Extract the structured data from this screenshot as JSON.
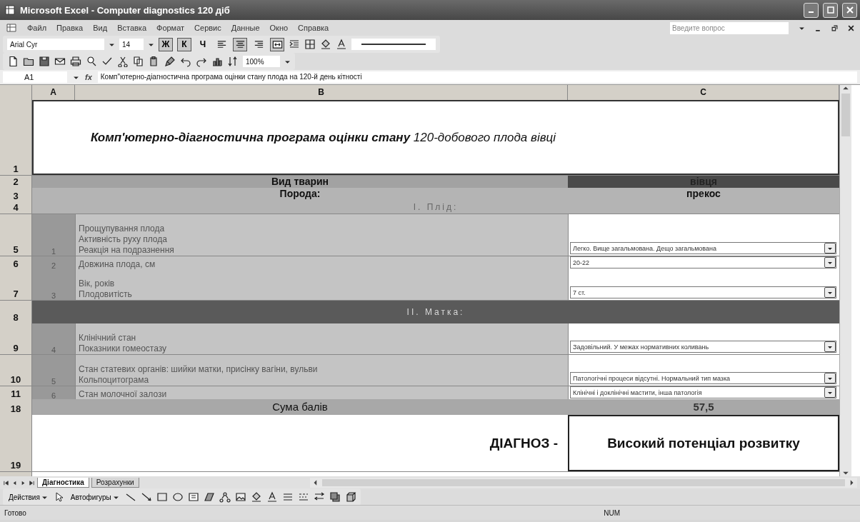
{
  "window": {
    "title": "Microsoft Excel - Computer diagnostics 120 діб"
  },
  "menu": [
    "Файл",
    "Правка",
    "Вид",
    "Вставка",
    "Формат",
    "Сервис",
    "Данные",
    "Окно",
    "Справка"
  ],
  "help_search": {
    "placeholder": "Введите вопрос"
  },
  "formatting_toolbar": {
    "font": "Arial Cyr",
    "size": "14",
    "style_buttons": [
      {
        "label": "Ж",
        "pressed": true
      },
      {
        "label": "К",
        "pressed": true
      },
      {
        "label": "Ч",
        "pressed": false
      }
    ],
    "align_buttons": [
      {
        "kind": "left",
        "pressed": false
      },
      {
        "kind": "center",
        "pressed": true
      },
      {
        "kind": "right",
        "pressed": false
      },
      {
        "kind": "merge",
        "pressed": true
      }
    ]
  },
  "standard_toolbar": {
    "zoom": "100%"
  },
  "formula_bar": {
    "cell": "A1",
    "fx": "fx",
    "content": "Комп\"ютерно-діагностична програма оцінки стану плода на 120-й день кітності"
  },
  "columns": [
    "A",
    "B",
    "C"
  ],
  "rows": [
    {
      "kind": "title",
      "number": "1",
      "text": "**Комп'ютерно-діагностична програма оцінки стану** 120-добового плода вівці"
    },
    {
      "kind": "pair",
      "number": "2",
      "highlighted": true,
      "label": "Вид тварин",
      "value": "вівця"
    },
    {
      "kind": "pair",
      "number": "3",
      "highlighted": false,
      "label": "Порода:",
      "value": "прекос"
    },
    {
      "kind": "section",
      "number": "4",
      "highlighted": false,
      "text": "І. Плід:"
    },
    {
      "kind": "item",
      "number": "5",
      "index": "1",
      "lines": [
        "Прощупування плода",
        "Активність руху плода",
        "Реакція на подразнення"
      ],
      "choice": "Легко. Вище загальмована. Дещо загальмована"
    },
    {
      "kind": "item",
      "number": "6",
      "index": "2",
      "lines": [
        "Довжина плода, см"
      ],
      "choice": "20-22"
    },
    {
      "kind": "item",
      "number": "7",
      "index": "3",
      "lines": [
        "Вік, років",
        "Плодовитість"
      ],
      "choice": "7 ст."
    },
    {
      "kind": "section",
      "number": "8",
      "highlighted": true,
      "text": "ІІ. Матка:"
    },
    {
      "kind": "item",
      "number": "9",
      "index": "4",
      "lines": [
        "Клінічний стан",
        "Показники гомеостазу"
      ],
      "choice": "Задовільний. У межах нормативних коливань"
    },
    {
      "kind": "item",
      "number": "10",
      "index": "5",
      "lines": [
        "Стан статевих органів: шийки матки, присінку вагіни, вульви",
        "Кольпоцитограма"
      ],
      "choice": "Патологічні процеси відсутні. Нормальний тип мазка"
    },
    {
      "kind": "item",
      "number": "11",
      "index": "6",
      "lines": [
        "Стан молочної залози"
      ],
      "choice": "Клінічні і доклінічні мастити, інша патологія"
    },
    {
      "kind": "total",
      "number": "18",
      "label": "Сума балів",
      "value": "57,5"
    },
    {
      "kind": "diagnosis",
      "number": "19",
      "label": "ДІАГНОЗ -",
      "value": "Високий потенціал розвитку"
    }
  ],
  "sheet_tabs": [
    {
      "label": "Діагностика",
      "selected": true
    },
    {
      "label": "Розрахунки",
      "selected": false
    }
  ],
  "drawing_toolbar": {
    "actions": "Действия",
    "autoshapes": "Автофигуры"
  },
  "status_bar": {
    "text": "Готово",
    "indicator": "NUM"
  }
}
